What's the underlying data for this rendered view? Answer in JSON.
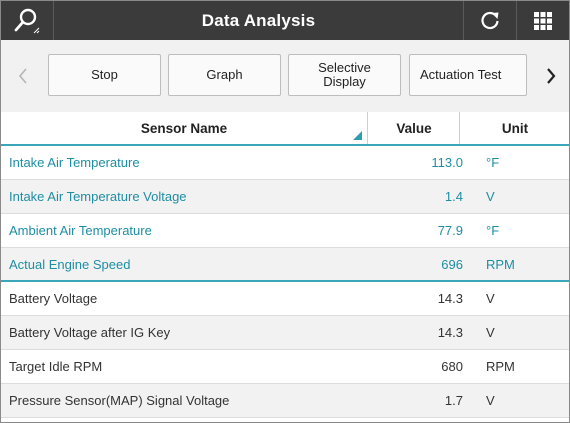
{
  "header": {
    "title": "Data Analysis",
    "search_icon": "search-icon",
    "refresh_icon": "refresh-icon",
    "grid_icon": "grid-menu-icon"
  },
  "toolbar": {
    "stop_label": "Stop",
    "graph_label": "Graph",
    "selective_label": "Selective\nDisplay",
    "actuation_label": "Actuation Test"
  },
  "table": {
    "columns": {
      "name": "Sensor Name",
      "value": "Value",
      "unit": "Unit"
    },
    "rows": [
      {
        "name": "Intake Air Temperature",
        "value": "113.0",
        "unit": "°F",
        "highlighted": true
      },
      {
        "name": "Intake Air Temperature Voltage",
        "value": "1.4",
        "unit": "V",
        "highlighted": true
      },
      {
        "name": "Ambient Air Temperature",
        "value": "77.9",
        "unit": "°F",
        "highlighted": true
      },
      {
        "name": "Actual Engine Speed",
        "value": "696",
        "unit": "RPM",
        "highlighted": true
      },
      {
        "name": "Battery Voltage",
        "value": "14.3",
        "unit": "V",
        "highlighted": false
      },
      {
        "name": "Battery Voltage after IG Key",
        "value": "14.3",
        "unit": "V",
        "highlighted": false
      },
      {
        "name": "Target Idle RPM",
        "value": "680",
        "unit": "RPM",
        "highlighted": false
      },
      {
        "name": "Pressure Sensor(MAP) Signal Voltage",
        "value": "1.7",
        "unit": "V",
        "highlighted": false
      }
    ]
  },
  "colors": {
    "header_bg": "#3b3b3b",
    "accent": "#1e8ea3",
    "row_alt": "#f2f2f2"
  }
}
